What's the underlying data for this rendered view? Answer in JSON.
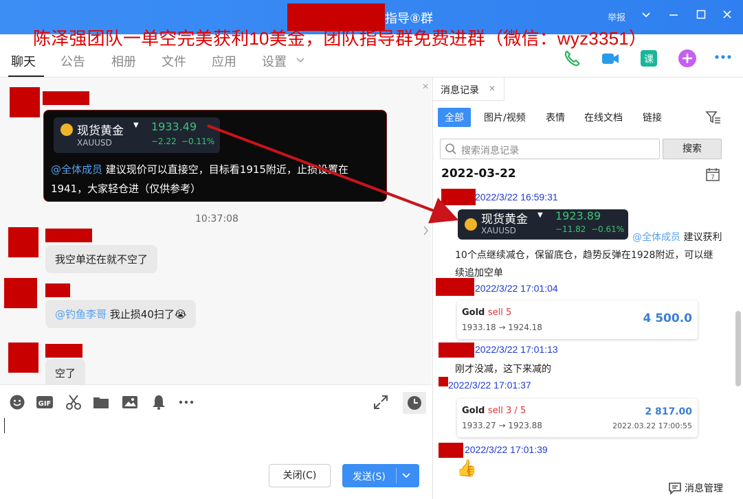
{
  "window": {
    "title": "指导⑧群",
    "report_label": "举报",
    "promo_banner": "陈泽强团队一单空完美获利10美金，团队指导群免费进群（微信：wyz3351）"
  },
  "tabs": [
    "聊天",
    "公告",
    "相册",
    "文件",
    "应用",
    "设置"
  ],
  "chat": {
    "ticker": {
      "name": "现货黄金",
      "symbol": "XAUUSD",
      "price": "1933.49",
      "change": "−2.22",
      "change_pct": "−0.11%"
    },
    "mention_all": "@全体成员",
    "card_message": " 建议现价可以直接空，目标看1915附近，止损设置在1941，大家轻仓进（仅供参考）",
    "time_divider": "10:37:08",
    "messages": [
      {
        "text": "我空单还在就不空了"
      },
      {
        "mention": "@钓鱼李哥",
        "text": " 我止损40扫了😭"
      },
      {
        "text": "空了"
      }
    ]
  },
  "composer": {
    "close_label": "关闭(C)",
    "send_label": "发送(S)"
  },
  "history": {
    "tab_label": "消息记录",
    "filters": [
      "全部",
      "图片/视频",
      "表情",
      "在线文档",
      "链接"
    ],
    "search_placeholder": "搜索消息记录",
    "search_button": "搜索",
    "date": "2022-03-22",
    "calendar_day": "7",
    "items": [
      {
        "time": "2022/3/22 16:59:31",
        "ticker": {
          "name": "现货黄金",
          "symbol": "XAUUSD",
          "price": "1923.89",
          "change": "−11.82",
          "change_pct": "−0.61%"
        },
        "mention": "@全体成员",
        "text_line1": " 建议获利",
        "text_line2": "10个点继续减仓，保留底仓，趋势反弹在1928附近，可以继",
        "text_line3": "续追加空单"
      },
      {
        "time": "2022/3/22 17:01:04",
        "trade": {
          "label": "Gold",
          "side": "sell 5",
          "prices": "1933.18 → 1924.18",
          "amount": "4 500.0"
        }
      },
      {
        "time": "2022/3/22 17:01:13",
        "text": "刚才没减，这下来减的"
      },
      {
        "time": "2022/3/22 17:01:37",
        "trade": {
          "label": "Gold",
          "side": "sell 3 / 5",
          "prices": "1933.27 → 1923.88",
          "amount": "2 817.00",
          "datetime": "2022.03.22 17:00:55"
        }
      },
      {
        "time": "2022/3/22 17:01:39",
        "emoji": "👍"
      }
    ],
    "manage_label": "消息管理"
  },
  "colors": {
    "accent": "#3a8ef5",
    "redaction": "#c80000",
    "promo": "#e00000",
    "timestamp": "#1f3ad6",
    "ticker_green": "#3bc27a"
  }
}
